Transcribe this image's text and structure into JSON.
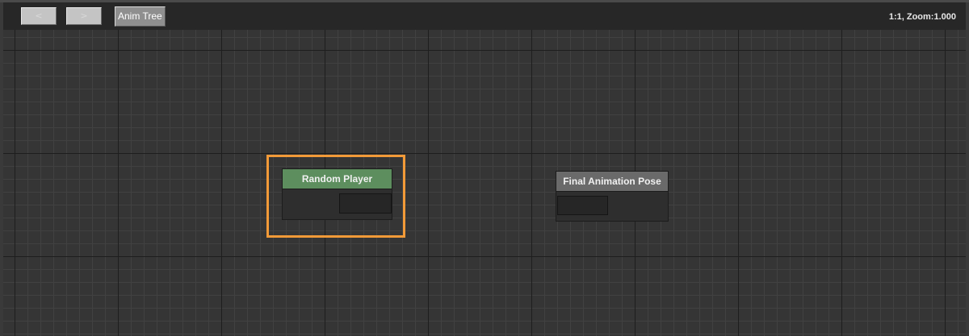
{
  "toolbar": {
    "back_glyph": "<",
    "forward_glyph": ">",
    "breadcrumb": "Anim Tree",
    "zoom_readout": "1:1, Zoom:1.000"
  },
  "graph": {
    "selected_node": "Random Player",
    "nodes": [
      {
        "title": "Random Player",
        "header_color": "#5d8e5e"
      },
      {
        "title": "Final Animation Pose",
        "header_color": "#6a6a6a"
      }
    ],
    "selection_color": "#f29a38"
  }
}
